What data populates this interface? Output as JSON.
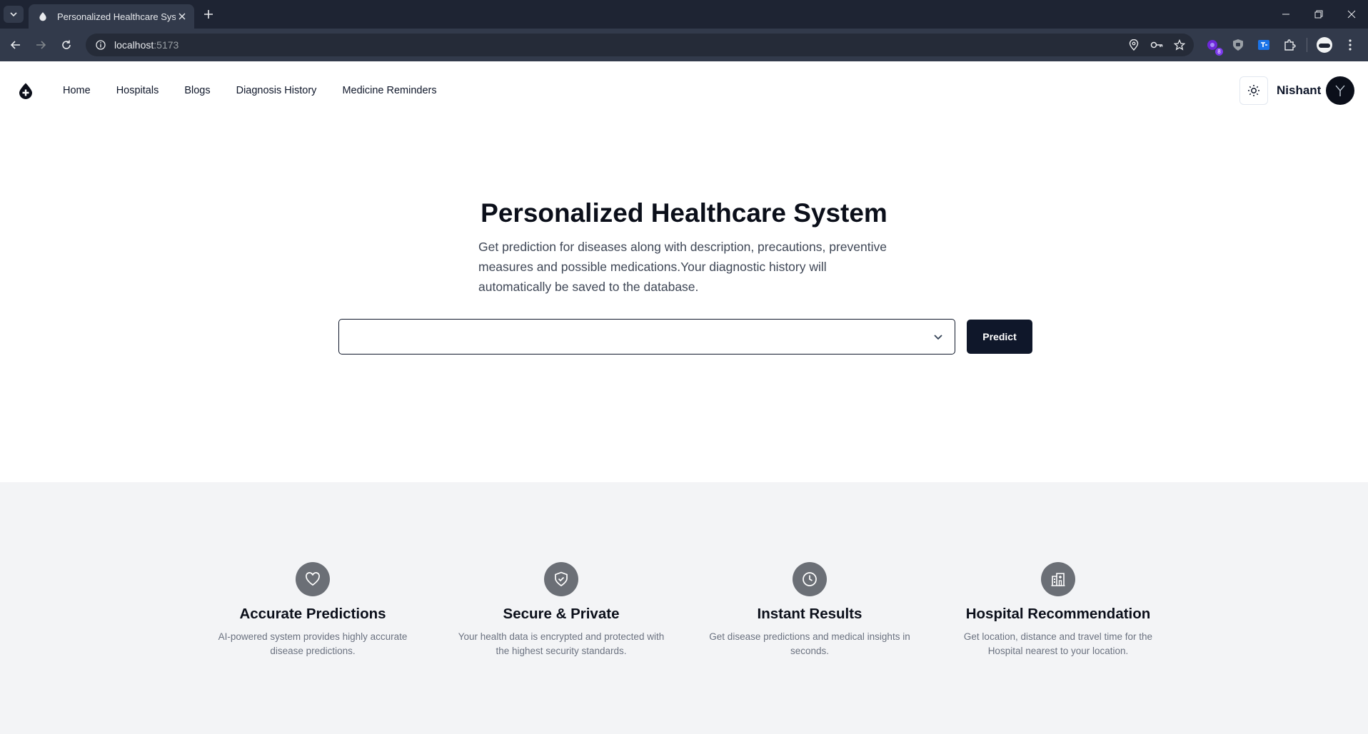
{
  "browser": {
    "tab_title": "Personalized Healthcare System",
    "url_host": "localhost",
    "url_port": ":5173",
    "extension_badge": "8"
  },
  "nav": {
    "items": [
      "Home",
      "Hospitals",
      "Blogs",
      "Diagnosis History",
      "Medicine Reminders"
    ]
  },
  "user": {
    "name": "Nishant"
  },
  "hero": {
    "title": "Personalized Healthcare System",
    "description": "Get prediction for diseases along with description, precautions, preventive measures and possible medications.Your diagnostic history will automatically be saved to the database.",
    "select_value": "",
    "predict_label": "Predict"
  },
  "features": [
    {
      "icon": "heart-icon",
      "title": "Accurate Predictions",
      "description": "AI-powered system provides highly accurate disease predictions."
    },
    {
      "icon": "shield-check-icon",
      "title": "Secure & Private",
      "description": "Your health data is encrypted and protected with the highest security standards."
    },
    {
      "icon": "clock-icon",
      "title": "Instant Results",
      "description": "Get disease predictions and medical insights in seconds."
    },
    {
      "icon": "hospital-icon",
      "title": "Hospital Recommendation",
      "description": "Get location, distance and travel time for the Hospital nearest to your location."
    }
  ],
  "colors": {
    "primary": "#0f172a",
    "feature_bg": "#f3f4f6",
    "feature_icon_bg": "#6b6f76",
    "chrome_dark": "#1e2433",
    "chrome_toolbar": "#323a4b"
  }
}
